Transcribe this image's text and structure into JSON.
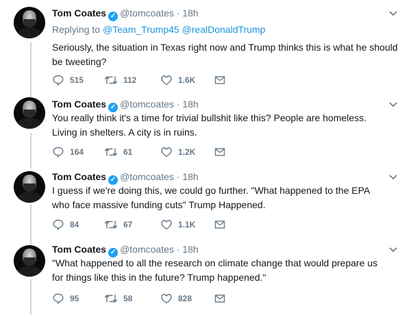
{
  "tweets": [
    {
      "name": "Tom Coates",
      "handle": "@tomcoates",
      "dot": "·",
      "time": "18h",
      "replying_prefix": "Replying to",
      "mentions": [
        "@Team_Trump45",
        "@realDonaldTrump"
      ],
      "text_lines": [
        "Seriously, the situation in Texas right now and Trump thinks this is what he should",
        "be tweeting?"
      ],
      "replies": "515",
      "retweets": "112",
      "likes": "1.6K"
    },
    {
      "name": "Tom Coates",
      "handle": "@tomcoates",
      "dot": "·",
      "time": "18h",
      "text_lines": [
        "You really think it's a time for trivial bullshit like this? People are homeless.",
        "Living in shelters. A city is in ruins."
      ],
      "replies": "164",
      "retweets": "61",
      "likes": "1.2K"
    },
    {
      "name": "Tom Coates",
      "handle": "@tomcoates",
      "dot": "·",
      "time": "18h",
      "text_lines": [
        "I guess if we're doing this, we could go further. \"What happened to the EPA",
        "who face massive funding cuts\" Trump Happened."
      ],
      "replies": "84",
      "retweets": "67",
      "likes": "1.1K"
    },
    {
      "name": "Tom Coates",
      "handle": "@tomcoates",
      "dot": "·",
      "time": "18h",
      "text_lines": [
        "\"What happened to all the research on climate change that would prepare us",
        "for things like this in the future? Trump happened.\""
      ],
      "replies": "95",
      "retweets": "58",
      "likes": "828"
    }
  ],
  "icons": {
    "reply": "reply-icon",
    "retweet": "retweet-icon",
    "like": "heart-icon",
    "dm": "envelope-icon",
    "caret": "chevron-down-icon",
    "verified": "verified-badge-icon"
  },
  "colors": {
    "link": "#1b95e0",
    "verified": "#1da1f2",
    "muted": "#657786",
    "thread_line": "#ccd6dd"
  }
}
